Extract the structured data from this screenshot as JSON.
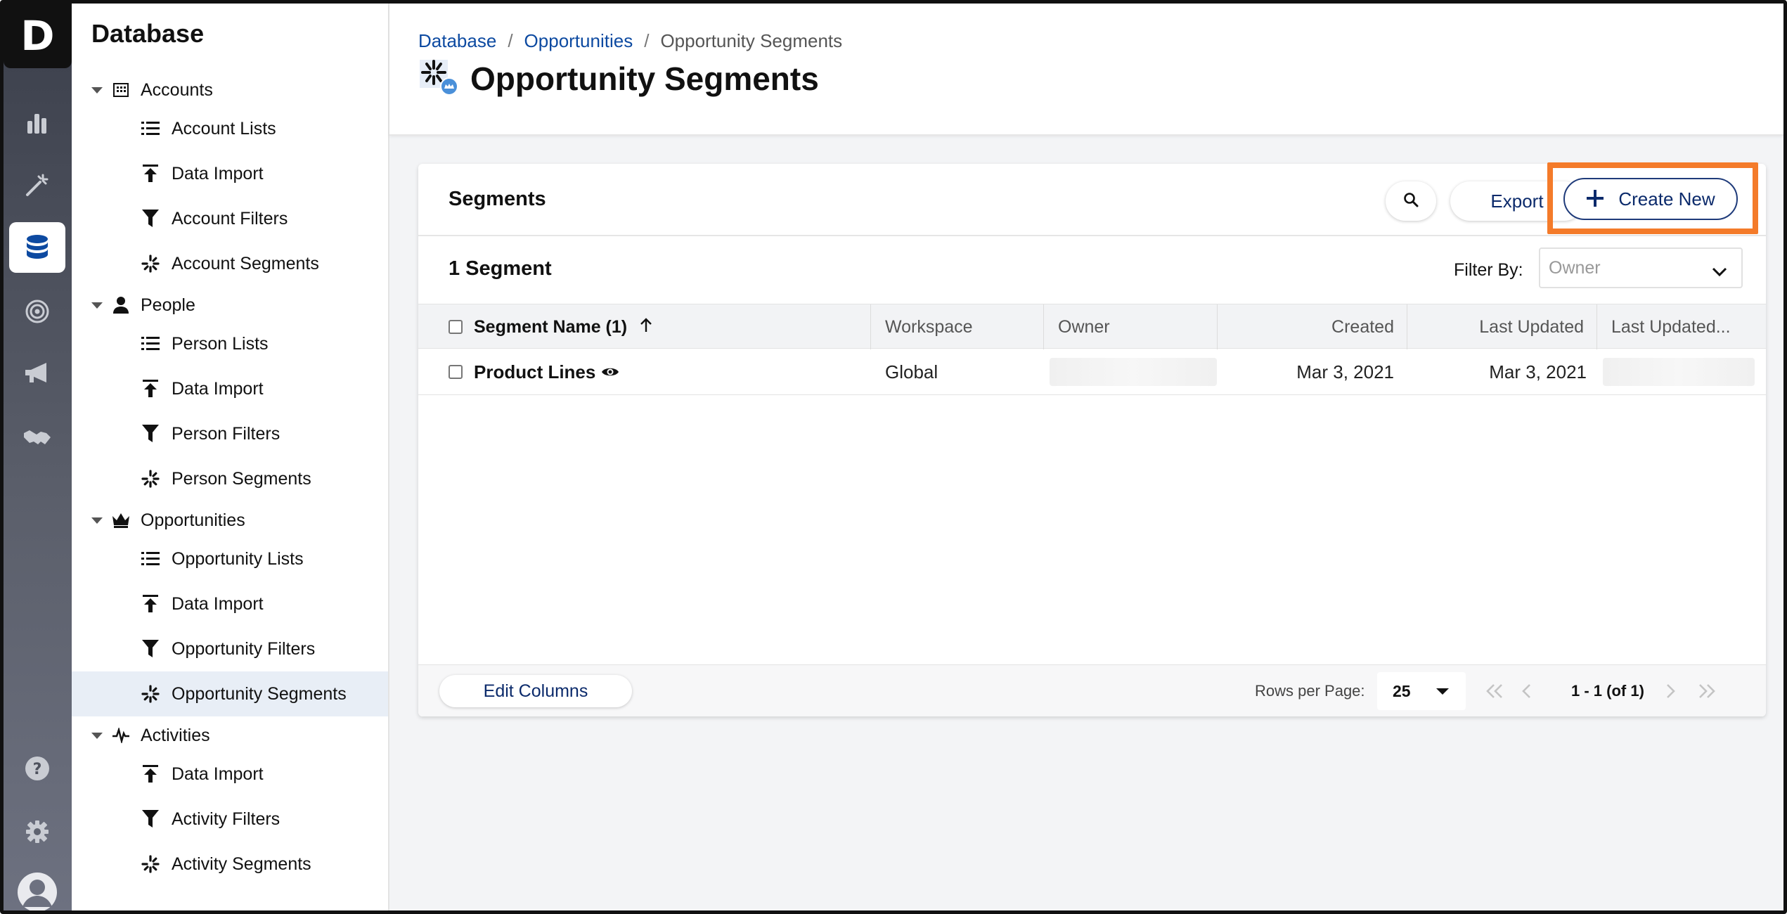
{
  "app": {
    "logo_letter": "D"
  },
  "rail": {
    "items": [
      {
        "name": "analytics-icon"
      },
      {
        "name": "magic-wand-icon"
      },
      {
        "name": "database-icon",
        "active": true
      },
      {
        "name": "target-icon"
      },
      {
        "name": "megaphone-icon"
      },
      {
        "name": "handshake-icon"
      },
      {
        "name": "help-icon"
      },
      {
        "name": "gear-icon"
      },
      {
        "name": "avatar-icon"
      }
    ]
  },
  "sidebar": {
    "title": "Database",
    "groups": [
      {
        "label": "Accounts",
        "items": [
          "Account Lists",
          "Data Import",
          "Account Filters",
          "Account Segments"
        ]
      },
      {
        "label": "People",
        "items": [
          "Person Lists",
          "Data Import",
          "Person Filters",
          "Person Segments"
        ]
      },
      {
        "label": "Opportunities",
        "items": [
          "Opportunity Lists",
          "Data Import",
          "Opportunity Filters",
          "Opportunity Segments"
        ]
      },
      {
        "label": "Activities",
        "items": [
          "Data Import",
          "Activity Filters",
          "Activity Segments"
        ]
      }
    ],
    "selected": "Opportunity Segments"
  },
  "header": {
    "breadcrumb": {
      "first": "Database",
      "second": "Opportunities",
      "current": "Opportunity Segments",
      "separator": "/"
    },
    "title": "Opportunity Segments"
  },
  "card": {
    "title": "Segments",
    "export_label": "Export",
    "create_label": "Create New",
    "count_label": "1 Segment",
    "filter_label": "Filter By:",
    "filter_placeholder": "Owner",
    "columns": {
      "name": "Segment Name (1)",
      "workspace": "Workspace",
      "owner": "Owner",
      "created": "Created",
      "last_updated": "Last Updated",
      "last_updated_by": "Last Updated..."
    },
    "rows": [
      {
        "name": "Product Lines",
        "workspace": "Global",
        "created": "Mar 3, 2021",
        "last_updated": "Mar 3, 2021"
      }
    ],
    "footer": {
      "edit_columns": "Edit Columns",
      "rows_per_page_label": "Rows per Page:",
      "rows_per_page": "25",
      "page_info": "1 - 1 (of 1)"
    }
  },
  "colors": {
    "accent": "#0d4aa1",
    "highlight": "#f47b2a",
    "button_text": "#0b2a6b"
  }
}
